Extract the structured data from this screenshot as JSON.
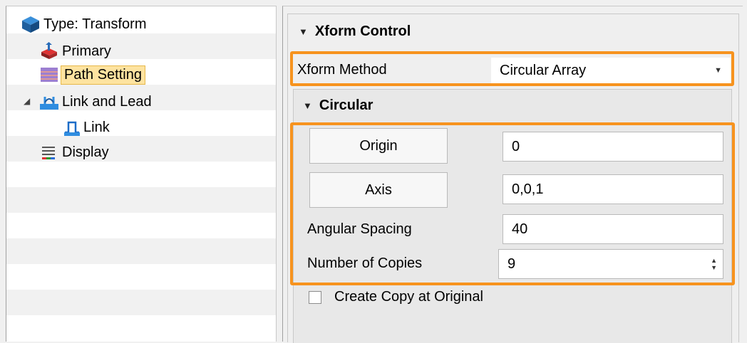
{
  "tree": {
    "items": [
      {
        "label": "Type: Transform",
        "icon": "cube-icon"
      },
      {
        "label": "Primary",
        "icon": "primary-icon"
      },
      {
        "label": "Path Setting",
        "icon": "path-setting-icon"
      },
      {
        "label": "Link and Lead",
        "icon": "link-and-lead-icon"
      },
      {
        "label": "Link",
        "icon": "link-icon"
      },
      {
        "label": "Display",
        "icon": "display-icon"
      }
    ],
    "selected": "Path Setting"
  },
  "xform_control": {
    "title": "Xform Control",
    "method_label": "Xform Method",
    "method_value": "Circular Array"
  },
  "circular": {
    "title": "Circular",
    "origin_label": "Origin",
    "origin_value": "0",
    "axis_label": "Axis",
    "axis_value": "0,0,1",
    "angular_label": "Angular Spacing",
    "angular_value": "40",
    "copies_label": "Number of Copies",
    "copies_value": "9"
  },
  "create_copy": {
    "label": "Create Copy at Original",
    "checked": false
  },
  "colors": {
    "highlight": "#f7931e",
    "selection_bg": "#fde3a0"
  }
}
